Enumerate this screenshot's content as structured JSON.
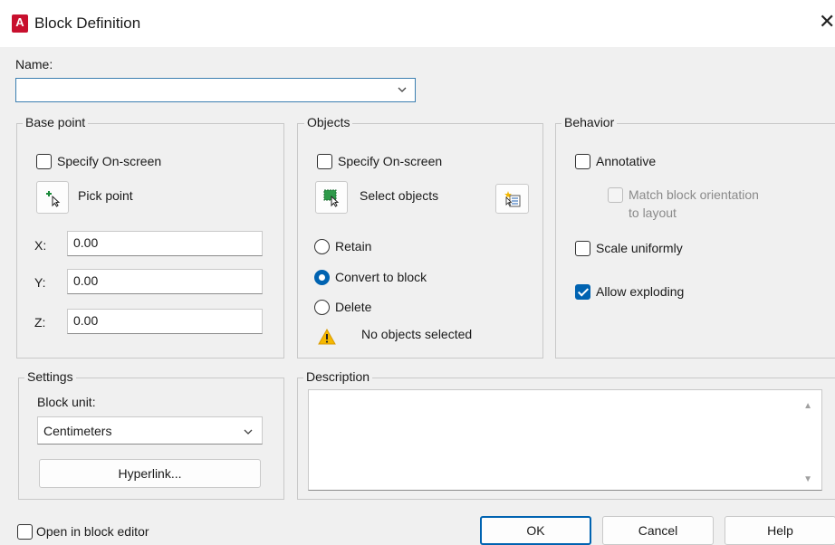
{
  "window": {
    "title": "Block Definition",
    "app_icon_letter": "A",
    "close_glyph": "✕"
  },
  "name": {
    "label": "Name:",
    "value": ""
  },
  "base_point": {
    "title": "Base point",
    "specify_on_screen": "Specify On-screen",
    "pick_point": "Pick point",
    "x_label": "X:",
    "x_value": "0.00",
    "y_label": "Y:",
    "y_value": "0.00",
    "z_label": "Z:",
    "z_value": "0.00"
  },
  "objects": {
    "title": "Objects",
    "specify_on_screen": "Specify On-screen",
    "select_objects": "Select objects",
    "retain": "Retain",
    "convert_to_block": "Convert to block",
    "delete": "Delete",
    "selected_option": "Convert to block",
    "status": "No objects selected"
  },
  "behavior": {
    "title": "Behavior",
    "annotative": "Annotative",
    "match_orientation_line1": "Match block orientation",
    "match_orientation_line2": "to layout",
    "scale_uniformly": "Scale uniformly",
    "allow_exploding": "Allow exploding",
    "allow_exploding_checked": true
  },
  "settings": {
    "title": "Settings",
    "block_unit_label": "Block unit:",
    "block_unit_value": "Centimeters",
    "hyperlink": "Hyperlink..."
  },
  "description": {
    "title": "Description",
    "value": ""
  },
  "footer": {
    "open_in_block_editor": "Open in block editor",
    "ok": "OK",
    "cancel": "Cancel",
    "help": "Help"
  },
  "colors": {
    "accent": "#0063b1",
    "brand": "#c8102e",
    "warning": "#f5b800"
  }
}
